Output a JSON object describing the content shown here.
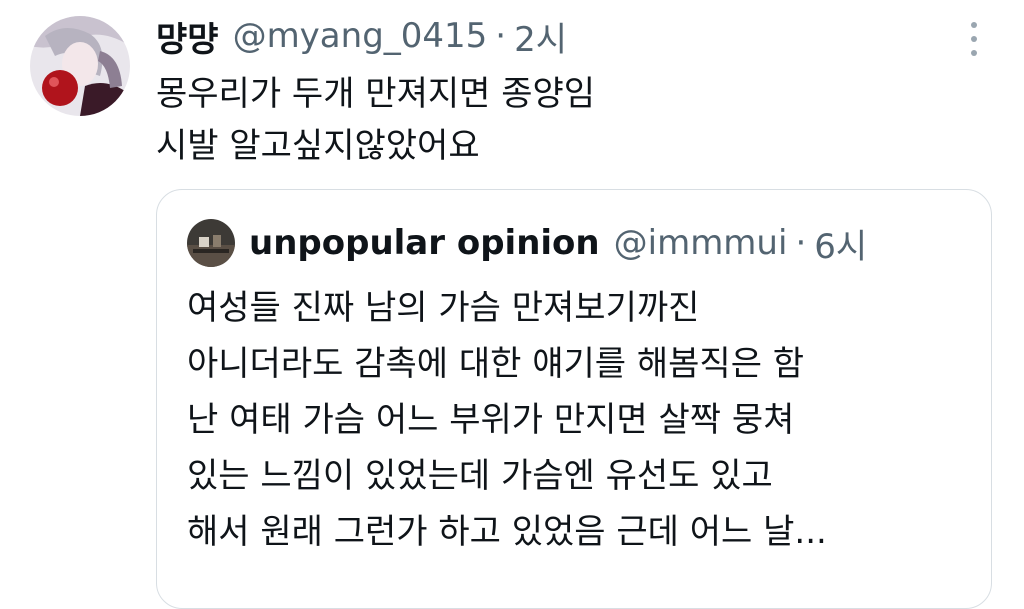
{
  "tweet": {
    "author_name": "먕먕",
    "handle": "@myang_0415",
    "separator": "·",
    "time": "2시",
    "lines": [
      "몽우리가 두개 만져지면 종양임",
      "시발 알고싶지않았어요"
    ]
  },
  "quoted": {
    "author_name": "unpopular opinion",
    "handle": "@immmui",
    "separator": "·",
    "time": "6시",
    "lines": [
      "여성들 진짜 남의 가슴 만져보기까진",
      "아니더라도 감촉에 대한 얘기를 해봄직은 함",
      "난 여태 가슴 어느 부위가 만지면 살짝 뭉쳐",
      "있는 느낌이 있었는데 가슴엔 유선도 있고",
      "해서 원래 그런가 하고 있었음 근데 어느 날..."
    ]
  },
  "icons": {
    "more": "more-vertical-icon"
  }
}
